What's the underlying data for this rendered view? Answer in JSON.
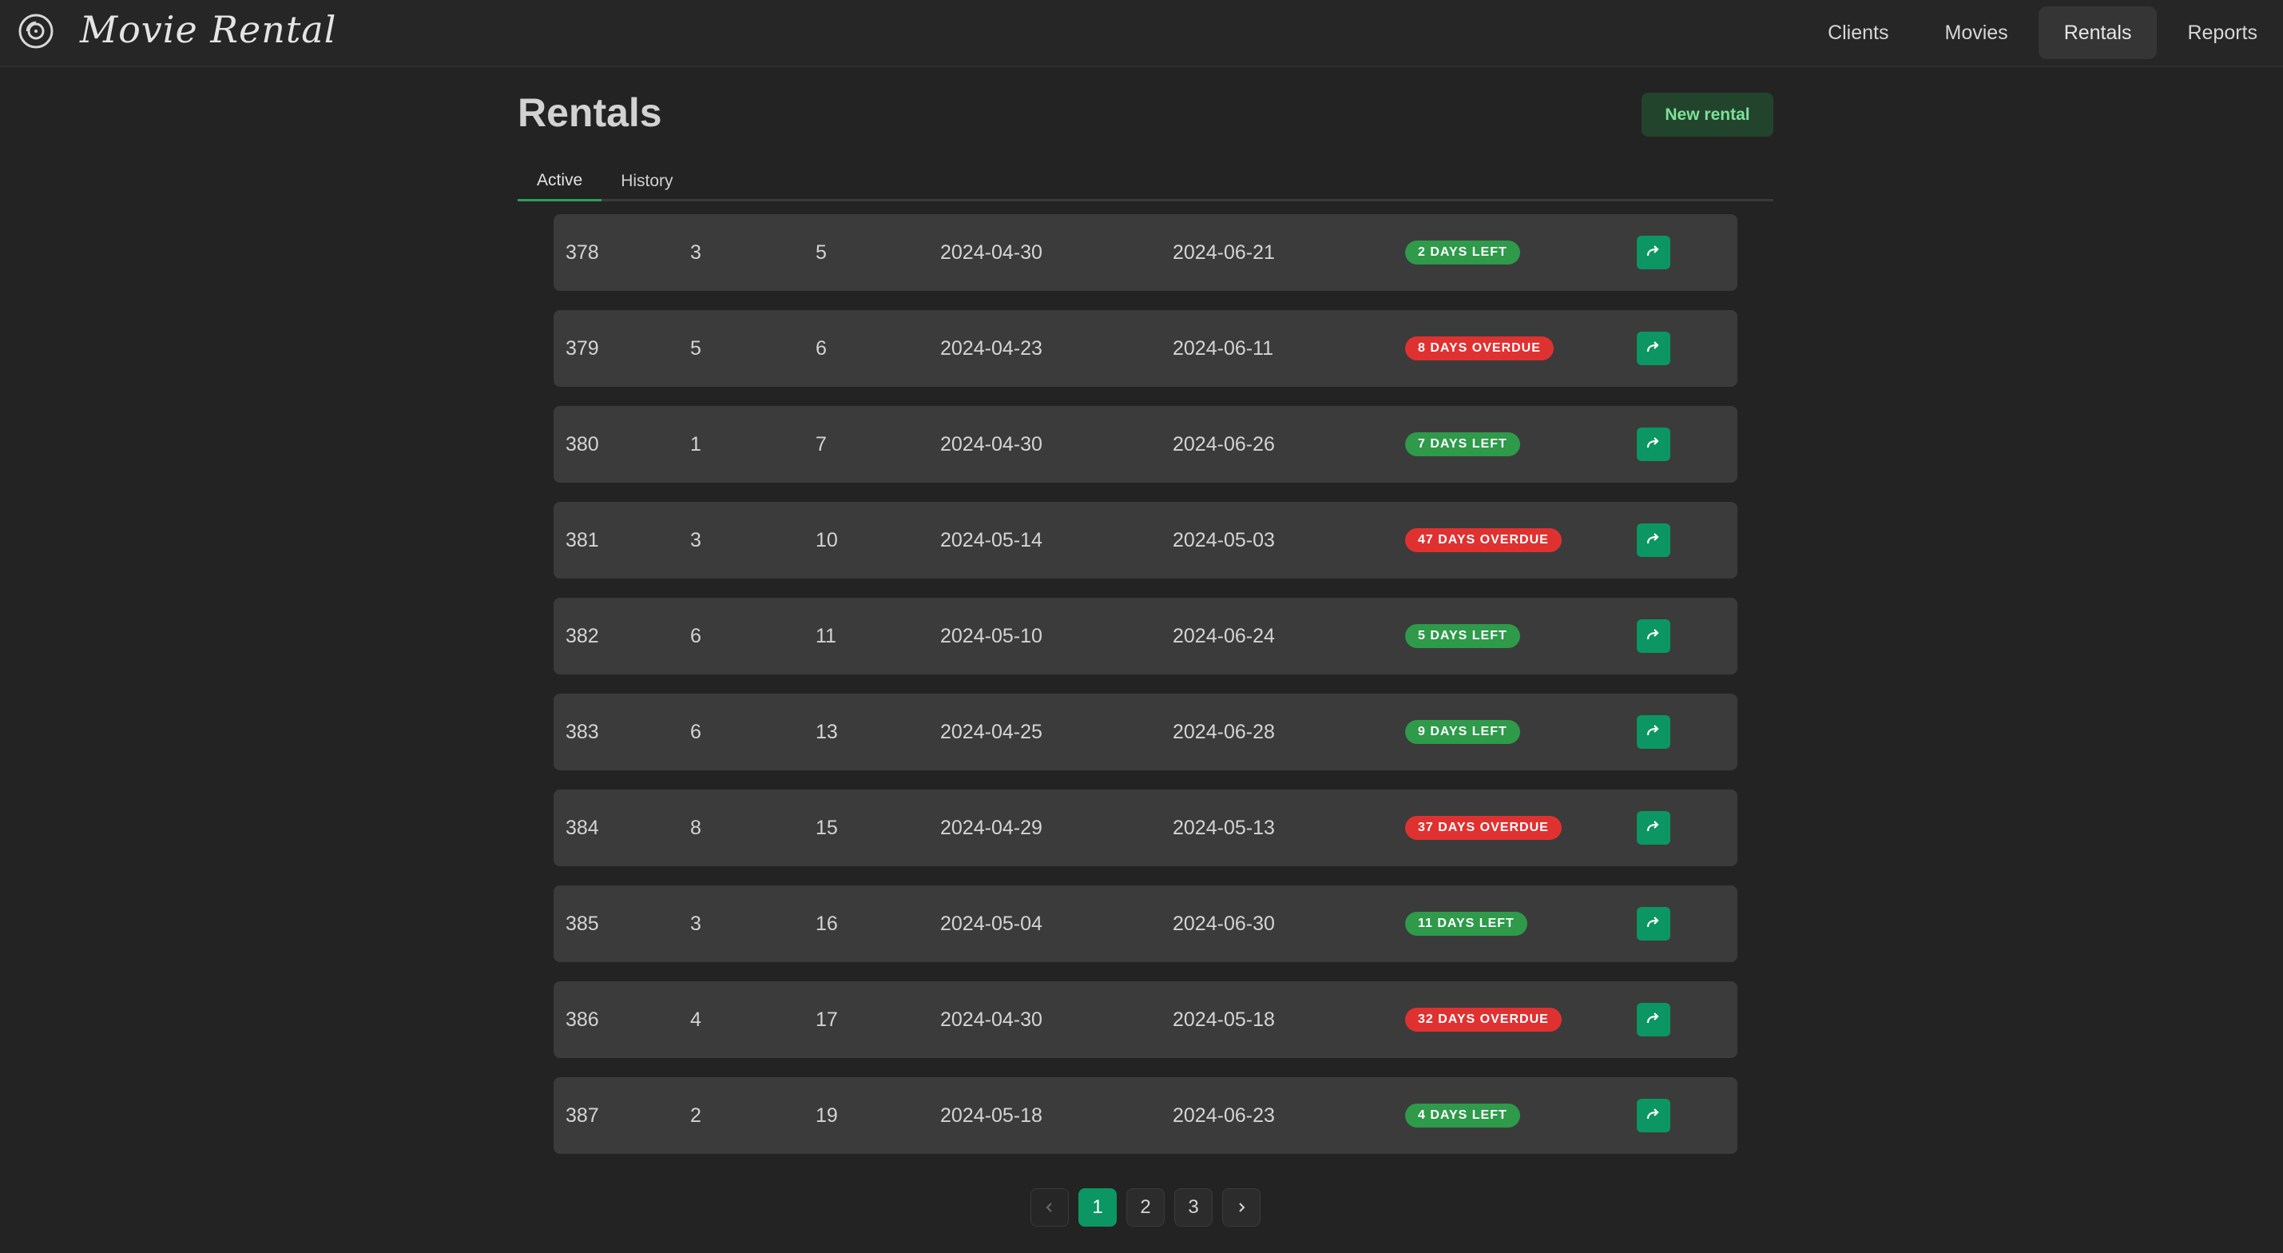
{
  "app": {
    "title": "Movie Rental"
  },
  "nav": {
    "items": [
      "Clients",
      "Movies",
      "Rentals",
      "Reports"
    ],
    "active": "Rentals"
  },
  "page": {
    "title": "Rentals",
    "new_button": "New rental"
  },
  "tabs": [
    {
      "label": "Active",
      "active": true
    },
    {
      "label": "History",
      "active": false
    }
  ],
  "rentals": [
    {
      "id": "378",
      "client": "3",
      "movie": "5",
      "start": "2024-04-30",
      "due": "2024-06-21",
      "status": "2 days left",
      "overdue": false
    },
    {
      "id": "379",
      "client": "5",
      "movie": "6",
      "start": "2024-04-23",
      "due": "2024-06-11",
      "status": "8 days overdue",
      "overdue": true
    },
    {
      "id": "380",
      "client": "1",
      "movie": "7",
      "start": "2024-04-30",
      "due": "2024-06-26",
      "status": "7 days left",
      "overdue": false
    },
    {
      "id": "381",
      "client": "3",
      "movie": "10",
      "start": "2024-05-14",
      "due": "2024-05-03",
      "status": "47 days overdue",
      "overdue": true
    },
    {
      "id": "382",
      "client": "6",
      "movie": "11",
      "start": "2024-05-10",
      "due": "2024-06-24",
      "status": "5 days left",
      "overdue": false
    },
    {
      "id": "383",
      "client": "6",
      "movie": "13",
      "start": "2024-04-25",
      "due": "2024-06-28",
      "status": "9 days left",
      "overdue": false
    },
    {
      "id": "384",
      "client": "8",
      "movie": "15",
      "start": "2024-04-29",
      "due": "2024-05-13",
      "status": "37 days overdue",
      "overdue": true
    },
    {
      "id": "385",
      "client": "3",
      "movie": "16",
      "start": "2024-05-04",
      "due": "2024-06-30",
      "status": "11 days left",
      "overdue": false
    },
    {
      "id": "386",
      "client": "4",
      "movie": "17",
      "start": "2024-04-30",
      "due": "2024-05-18",
      "status": "32 days overdue",
      "overdue": true
    },
    {
      "id": "387",
      "client": "2",
      "movie": "19",
      "start": "2024-05-18",
      "due": "2024-06-23",
      "status": "4 days left",
      "overdue": false
    }
  ],
  "pagination": {
    "pages": [
      "1",
      "2",
      "3"
    ],
    "current": "1",
    "prev_icon": "chevron-left-icon",
    "next_icon": "chevron-right-icon"
  },
  "colors": {
    "accent": "#0c9663",
    "ok": "#2e9a4a",
    "overdue": "#e03131"
  }
}
